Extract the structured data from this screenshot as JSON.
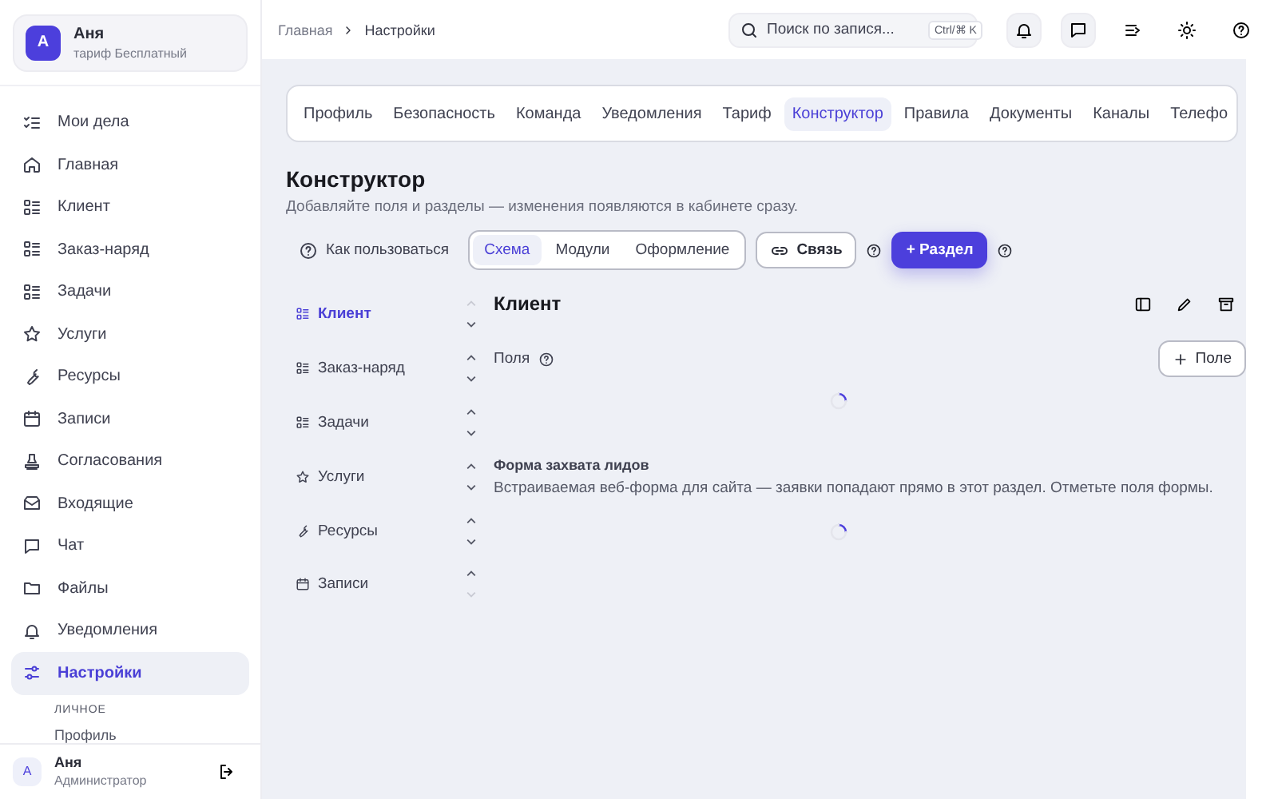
{
  "account": {
    "avatar": "А",
    "name": "Аня",
    "plan": "тариф Бесплатный"
  },
  "nav": [
    {
      "label": "Мои дела",
      "selected": false
    },
    {
      "label": "Главная",
      "selected": false
    },
    {
      "label": "Клиент",
      "selected": false
    },
    {
      "label": "Заказ-наряд",
      "selected": false
    },
    {
      "label": "Задачи",
      "selected": false
    },
    {
      "label": "Услуги",
      "selected": false
    },
    {
      "label": "Ресурсы",
      "selected": false
    },
    {
      "label": "Записи",
      "selected": false
    },
    {
      "label": "Согласования",
      "selected": false
    },
    {
      "label": "Входящие",
      "selected": false
    },
    {
      "label": "Чат",
      "selected": false
    },
    {
      "label": "Файлы",
      "selected": false
    },
    {
      "label": "Уведомления",
      "selected": false
    },
    {
      "label": "Настройки",
      "selected": true
    }
  ],
  "nav_group": {
    "heading": "ЛИЧНОЕ",
    "items": [
      "Профиль"
    ]
  },
  "user": {
    "avatar": "А",
    "name": "Аня",
    "role": "Администратор"
  },
  "breadcrumbs": [
    "Главная",
    "Настройки"
  ],
  "search": {
    "placeholder": "Поиск по запися...",
    "shortcut": "Ctrl/⌘ K"
  },
  "settings_tabs": [
    {
      "label": "Профиль",
      "selected": false
    },
    {
      "label": "Безопасность",
      "selected": false
    },
    {
      "label": "Команда",
      "selected": false
    },
    {
      "label": "Уведомления",
      "selected": false
    },
    {
      "label": "Тариф",
      "selected": false
    },
    {
      "label": "Конструктор",
      "selected": true
    },
    {
      "label": "Правила",
      "selected": false
    },
    {
      "label": "Документы",
      "selected": false
    },
    {
      "label": "Каналы",
      "selected": false
    },
    {
      "label": "Телефо",
      "selected": false
    }
  ],
  "page": {
    "title": "Конструктор",
    "subtitle": "Добавляйте поля и разделы — изменения появляются в кабинете сразу."
  },
  "toolbar": {
    "help_link": "Как пользоваться",
    "modes": [
      {
        "label": "Схема",
        "selected": true
      },
      {
        "label": "Модули",
        "selected": false
      },
      {
        "label": "Оформление",
        "selected": false
      }
    ],
    "link_button": "Связь",
    "add_button": "+ Раздел"
  },
  "sections": [
    {
      "label": "Клиент",
      "selected": true,
      "up_disabled": true,
      "down_disabled": false
    },
    {
      "label": "Заказ-наряд",
      "selected": false,
      "up_disabled": false,
      "down_disabled": false
    },
    {
      "label": "Задачи",
      "selected": false,
      "up_disabled": false,
      "down_disabled": false
    },
    {
      "label": "Услуги",
      "selected": false,
      "up_disabled": false,
      "down_disabled": false
    },
    {
      "label": "Ресурсы",
      "selected": false,
      "up_disabled": false,
      "down_disabled": false
    },
    {
      "label": "Записи",
      "selected": false,
      "up_disabled": false,
      "down_disabled": true
    }
  ],
  "detail": {
    "title": "Клиент",
    "fields_label": "Поля",
    "add_field": "Поле",
    "fields_loading": true,
    "form_title": "Форма захвата лидов",
    "form_text": "Встраиваемая веб-форма для сайта — заявки попадают прямо в этот раздел. Отметьте поля формы.",
    "form_loading": true
  }
}
